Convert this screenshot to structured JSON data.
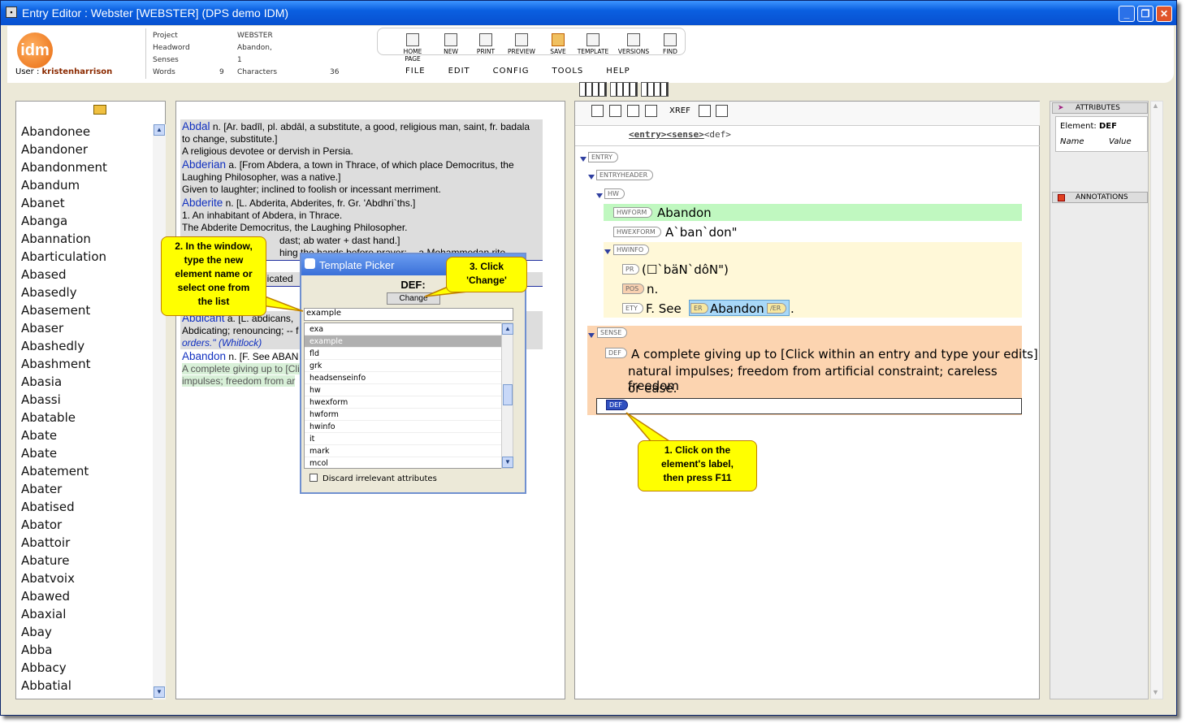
{
  "window": {
    "title": "Entry Editor : Webster [WEBSTER] (DPS demo IDM)"
  },
  "header": {
    "logo": "idm",
    "user_label": "User :",
    "user_name": "kristenharrison",
    "info": {
      "project_label": "Project",
      "project": "WEBSTER",
      "headword_label": "Headword",
      "headword": "Abandon,",
      "senses_label": "Senses",
      "senses": "1",
      "words_label": "Words",
      "words": "9",
      "characters_label": "Characters",
      "characters": "36"
    },
    "toolbar": [
      "HOME PAGE",
      "NEW",
      "PRINT",
      "PREVIEW",
      "SAVE",
      "TEMPLATE",
      "VERSIONS",
      "FIND"
    ],
    "menu": [
      "FILE",
      "EDIT",
      "CONFIG",
      "TOOLS",
      "HELP"
    ]
  },
  "wordlist": [
    "Abandonee",
    "Abandoner",
    "Abandonment",
    "Abandum",
    "Abanet",
    "Abanga",
    "Abannation",
    "Abarticulation",
    "Abased",
    "Abasedly",
    "Abasement",
    "Abaser",
    "Abashedly",
    "Abashment",
    "Abasia",
    "Abassi",
    "Abatable",
    "Abate",
    "Abate",
    "Abatement",
    "Abater",
    "Abatised",
    "Abator",
    "Abattoir",
    "Abature",
    "Abatvoix",
    "Abawed",
    "Abaxial",
    "Abay",
    "Abba",
    "Abbacy",
    "Abbatial"
  ],
  "entries": {
    "e1_hw": "Abdal",
    "e1_l1": " n. [Ar. badīl, pl. abdāl, a substitute, a good, religious man, saint, fr. badala",
    "e1_l2": "to change, substitute.]",
    "e1_l3": "A religious devotee or dervish in Persia.",
    "e2_hw": "Abderian",
    "e2_l1": " a. [From Abdera, a town in Thrace, of which place Democritus, the",
    "e2_l2": "Laughing Philosopher, was a native.]",
    "e2_l3": "Given to laughter; inclined to foolish or incessant merriment.",
    "e3_hw": "Abderite",
    "e3_l1": " n. [L. Abderita, Abderites, fr. Gr. 'Abdhri`ths.]",
    "e3_l2": "1. An inhabitant of Abdera, in Thrace.",
    "e3_l3": "The Abderite Democritus, the Laughing Philosopher.",
    "e4_l1": "dast; ab water + dast hand.]",
    "e4_l2": "hing the hands before prayer; -- a Mohammedan rite.",
    "e5_l1": "dicated",
    "e6_hw": "Abdicant",
    "e6_l1": " a. [L. abdicans,",
    "e6_l2": "Abdicating; renouncing; -- f",
    "e6_l3": "orders.\" (Whitlock)",
    "e7_hw": "Abandon",
    "e7_l1": " n. [F. See ABAN",
    "e7_l2": "A complete giving up to [Cli",
    "e7_l3": "impulses; freedom from ar"
  },
  "editor": {
    "xref": "XREF",
    "breadcrumb": [
      "<entry>",
      "<sense>",
      "<def>"
    ],
    "tags": {
      "entry": "ENTRY",
      "entryheader": "ENTRYHEADER",
      "hw": "HW",
      "hwform": "HWFORM",
      "hwexform": "HWEXFORM",
      "hwinfo": "HWINFO",
      "pr": "PR",
      "pos": "POS",
      "ety": "ETY",
      "er": "ER",
      "er_end": "/ER",
      "sense": "SENSE",
      "def": "DEF"
    },
    "hwform": "Abandon",
    "hwexform": "A`ban`don\"",
    "pr": "(☐`bäN`dôN\")",
    "pos": "n.",
    "ety_pre": "F. See ",
    "ety_ref": "Abandon",
    "ety_post": ".",
    "def_l1": "A complete giving up to [Click within an entry and type your edits]",
    "def_l2": "natural impulses; freedom from artificial constraint; careless freedom",
    "def_l3": "or ease."
  },
  "attributes": {
    "title": "ATTRIBUTES",
    "element_label": "Element:",
    "element": "DEF",
    "name_col": "Name",
    "value_col": "Value",
    "annotations": "ANNOTATIONS"
  },
  "picker": {
    "title": "Template Picker",
    "tag": "DEF:",
    "change": "Change",
    "input": "example",
    "items": [
      "exa",
      "example",
      "fld",
      "grk",
      "headsenseinfo",
      "hw",
      "hwexform",
      "hwform",
      "hwinfo",
      "it",
      "mark",
      "mcol"
    ],
    "selected": 1,
    "discard": "Discard irrelevant attributes"
  },
  "callouts": {
    "c1": [
      "1. Click on the",
      "element's label,",
      "then press F11"
    ],
    "c2": [
      "2. In the window,",
      "type the new",
      "element name or",
      "select one from",
      "the list"
    ],
    "c3": [
      "3. Click",
      "'Change'"
    ]
  }
}
